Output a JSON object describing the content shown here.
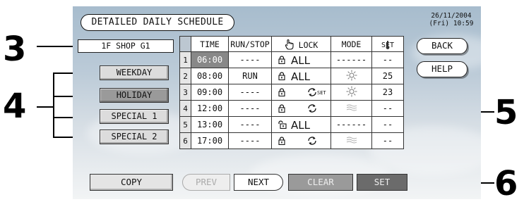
{
  "title": "DETAILED DAILY SCHEDULE",
  "datetime": {
    "date": "26/11/2004",
    "time": "(Fri) 10:59"
  },
  "group_name": "1F SHOP G1",
  "day_buttons": [
    {
      "label": "WEEKDAY",
      "selected": false
    },
    {
      "label": "HOLIDAY",
      "selected": true
    },
    {
      "label": "SPECIAL 1",
      "selected": false
    },
    {
      "label": "SPECIAL 2",
      "selected": false
    }
  ],
  "table": {
    "headers": {
      "time": "TIME",
      "run_stop": "RUN/STOP",
      "lock": "LOCK",
      "mode": "MODE",
      "set": "SET"
    },
    "rows": [
      {
        "index": "1",
        "time": "06:00",
        "run_stop": "----",
        "lock_icon": "closed-padlock-icon",
        "lock": "ALL",
        "mode": "------",
        "mode_icon": "",
        "set": "--"
      },
      {
        "index": "2",
        "time": "08:00",
        "run_stop": "RUN",
        "lock_icon": "closed-padlock-icon",
        "lock": "ALL",
        "mode": "",
        "mode_icon": "sun-icon",
        "set": "25"
      },
      {
        "index": "3",
        "time": "09:00",
        "run_stop": "----",
        "lock_icon": "closed-padlock-icon",
        "lock": "",
        "lock_extra": "rotate-set-icon",
        "mode": "",
        "mode_icon": "sun-icon",
        "set": "23"
      },
      {
        "index": "4",
        "time": "12:00",
        "run_stop": "----",
        "lock_icon": "closed-padlock-icon",
        "lock": "",
        "lock_extra": "rotate-icon",
        "mode": "",
        "mode_icon": "wave-icon",
        "set": "--"
      },
      {
        "index": "5",
        "time": "13:00",
        "run_stop": "----",
        "lock_icon": "open-padlock-icon",
        "lock": "ALL",
        "mode": "------",
        "mode_icon": "",
        "set": "--"
      },
      {
        "index": "6",
        "time": "17:00",
        "run_stop": "----",
        "lock_icon": "closed-padlock-icon",
        "lock": "",
        "lock_extra": "rotate-icon",
        "mode": "",
        "mode_icon": "wave-icon",
        "set": "--"
      }
    ]
  },
  "right_buttons": {
    "back": "BACK",
    "help": "HELP"
  },
  "bottom_buttons": {
    "copy": "COPY",
    "prev": "PREV",
    "next": "NEXT",
    "clear": "CLEAR",
    "set": "SET"
  },
  "callouts": {
    "c3": "3",
    "c4": "4",
    "c5": "5",
    "c6": "6"
  },
  "colors": {
    "selected_day": "#9a9a9a",
    "time_highlight": "#888888",
    "clear_button": "#9a9a9a",
    "set_button": "#6b6b6b"
  }
}
